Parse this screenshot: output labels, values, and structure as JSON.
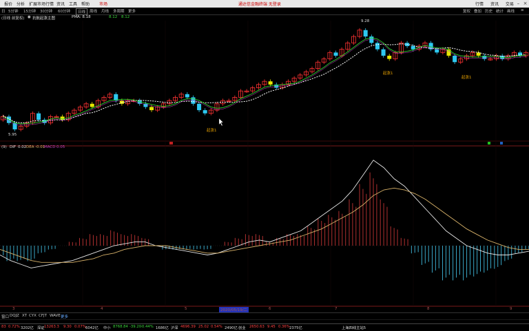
{
  "menubar": {
    "items": [
      "报价",
      "分析",
      "扩展市场行情",
      "资讯",
      "工具",
      "帮助"
    ],
    "active_item": "市场",
    "center_text": "通达信金融终端 无登录",
    "right_labels": [
      "行情",
      "资讯",
      "交易"
    ]
  },
  "toolbar": {
    "periods": [
      "日",
      "5分钟",
      "15分钟",
      "30分钟",
      "60分钟",
      "日线",
      "周线",
      "月线",
      "多周期",
      "更多"
    ],
    "right_buttons": [
      "复权",
      "叠加",
      "历史",
      "统计",
      "画线",
      "≡"
    ]
  },
  "kline_header": {
    "prefix": "(日线 前复权)",
    "indicator": "抗航起涨主图",
    "pma": "PMA: 8.18",
    "ma2": "8.12",
    "ma3": "8.12"
  },
  "kline_labels": {
    "high": "9.28",
    "low": "5.95",
    "signals": [
      "起涨1",
      "起涨1",
      "起涨1"
    ]
  },
  "macd_header": {
    "name": "(9)",
    "dif_label": "DIF",
    "dif": "0.02",
    "dea_label": "DEA",
    "dea": "-0.01",
    "macd_label": "MACD",
    "macd": "0.05"
  },
  "axis": {
    "dates": [
      "3",
      "4",
      "5",
      "6",
      "7",
      "8",
      "9"
    ],
    "cursor_date": "2020/05/19/二"
  },
  "tabs": [
    "窗口",
    "DQJZ",
    "XT",
    "CYX",
    "CFJT",
    "WAVE",
    "更多"
  ],
  "status": [
    {
      "text": "83",
      "cls": "red"
    },
    {
      "text": "0.72%",
      "cls": "red"
    },
    {
      "text": "3202亿",
      "cls": "wht"
    },
    {
      "text": "深证",
      "cls": "wht"
    },
    {
      "text": "13263.3",
      "cls": "red"
    },
    {
      "text": "9.30",
      "cls": "red"
    },
    {
      "text": "0.07%",
      "cls": "red"
    },
    {
      "text": "6042亿",
      "cls": "wht"
    },
    {
      "text": "中小",
      "cls": "wht"
    },
    {
      "text": "8768.84",
      "cls": "grn"
    },
    {
      "text": "-39.20",
      "cls": "grn"
    },
    {
      "text": "-0.44%",
      "cls": "grn"
    },
    {
      "text": "1686亿",
      "cls": "wht"
    },
    {
      "text": "沪深",
      "cls": "wht"
    },
    {
      "text": "4696.39",
      "cls": "red"
    },
    {
      "text": "25.02",
      "cls": "red"
    },
    {
      "text": "0.54%",
      "cls": "red"
    },
    {
      "text": "2490亿",
      "cls": "wht"
    },
    {
      "text": "创业",
      "cls": "wht"
    },
    {
      "text": "2650.63",
      "cls": "red"
    },
    {
      "text": "9.45",
      "cls": "red"
    },
    {
      "text": "0.36%",
      "cls": "red"
    },
    {
      "text": "2375亿",
      "cls": "wht"
    },
    {
      "text": "上海四线主站5",
      "cls": "wht"
    }
  ],
  "colors": {
    "up": "#ff3333",
    "down": "#2ec8f0",
    "yellow": "#e6e600",
    "dif": "#e8e8e8",
    "dea": "#d9b36a"
  },
  "chart_data": {
    "type": "candlestick",
    "price_range": [
      5.95,
      9.28
    ],
    "closes": [
      6.5,
      6.3,
      6.1,
      6.2,
      6.3,
      6.6,
      6.4,
      6.3,
      6.5,
      6.5,
      6.4,
      6.6,
      6.7,
      6.8,
      6.9,
      6.8,
      7.0,
      7.1,
      7.2,
      7.0,
      6.9,
      7.0,
      7.0,
      6.9,
      6.8,
      6.7,
      6.8,
      6.9,
      7.0,
      7.1,
      7.2,
      7.1,
      6.9,
      6.7,
      6.6,
      6.7,
      6.9,
      7.0,
      7.0,
      7.1,
      7.3,
      7.3,
      7.4,
      7.5,
      7.6,
      7.5,
      7.4,
      7.5,
      7.6,
      7.7,
      7.8,
      7.9,
      8.0,
      8.2,
      8.3,
      8.5,
      8.4,
      8.6,
      8.8,
      9.0,
      9.2,
      9.0,
      8.8,
      8.6,
      8.4,
      8.3,
      8.5,
      8.8,
      8.7,
      8.6,
      8.7,
      8.8,
      8.6,
      8.5,
      8.6,
      8.4,
      8.2,
      8.3,
      8.4,
      8.5,
      8.4,
      8.3,
      8.3,
      8.4,
      8.3,
      8.4,
      8.5,
      8.4,
      8.5
    ],
    "macd": {
      "dif": [
        -0.05,
        -0.08,
        -0.1,
        -0.12,
        -0.11,
        -0.1,
        -0.09,
        -0.08,
        -0.06,
        -0.04,
        -0.02,
        0.0,
        0.01,
        0.02,
        0.02,
        0.0,
        -0.01,
        -0.02,
        -0.03,
        -0.04,
        -0.05,
        -0.04,
        -0.02,
        0.0,
        0.02,
        0.03,
        0.02,
        0.04,
        0.06,
        0.08,
        0.12,
        0.16,
        0.2,
        0.24,
        0.3,
        0.38,
        0.46,
        0.42,
        0.36,
        0.32,
        0.26,
        0.2,
        0.14,
        0.08,
        0.04,
        0.0,
        -0.02,
        -0.04,
        -0.05,
        -0.05,
        -0.04,
        -0.03
      ],
      "dea": [
        -0.02,
        -0.04,
        -0.06,
        -0.08,
        -0.09,
        -0.09,
        -0.09,
        -0.09,
        -0.08,
        -0.07,
        -0.05,
        -0.04,
        -0.02,
        -0.01,
        0.0,
        0.0,
        -0.0,
        -0.01,
        -0.02,
        -0.03,
        -0.04,
        -0.04,
        -0.03,
        -0.02,
        -0.01,
        0.0,
        0.01,
        0.02,
        0.03,
        0.05,
        0.07,
        0.09,
        0.12,
        0.15,
        0.18,
        0.22,
        0.27,
        0.3,
        0.31,
        0.3,
        0.28,
        0.25,
        0.21,
        0.17,
        0.13,
        0.09,
        0.06,
        0.03,
        0.01,
        -0.01,
        -0.02,
        -0.02
      ]
    }
  }
}
